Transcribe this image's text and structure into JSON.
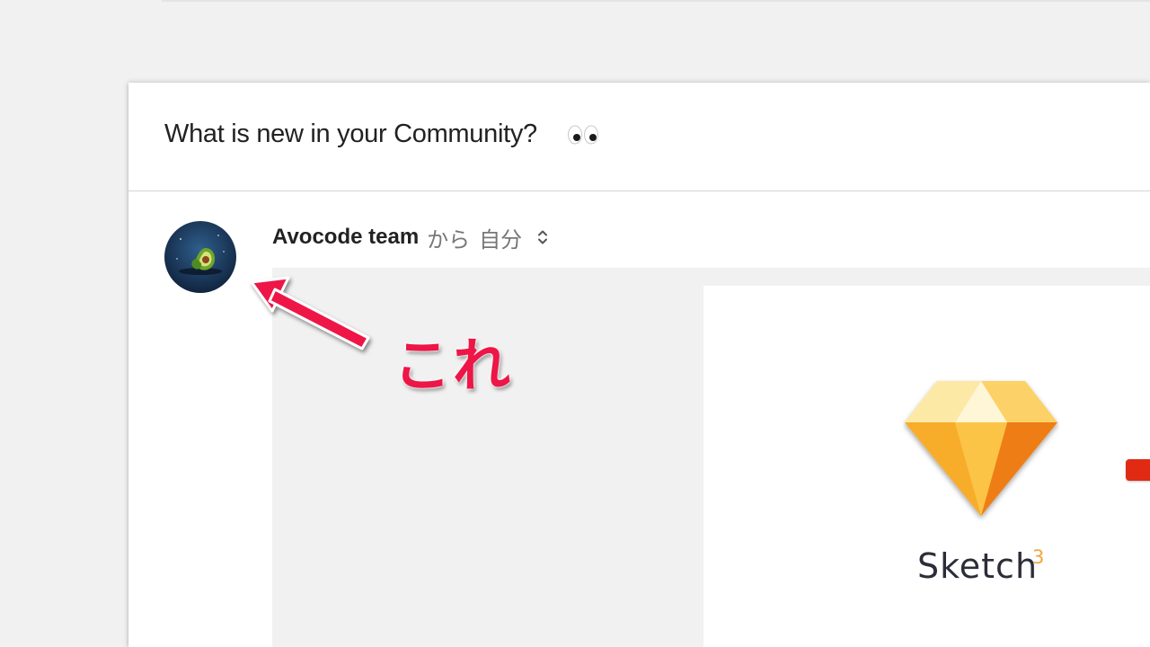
{
  "email": {
    "subject": "What is new in your Community?",
    "subject_emoji_icon": "eyes-emoji-icon",
    "sender_name": "Avocode team",
    "sender_from_label": "から",
    "recipient_label": "自分",
    "details_icon": "up-down-chevron-icon",
    "avatar_icon": "avocado-logo-icon"
  },
  "newsletter": {
    "logo_icon": "sketch-diamond-icon",
    "product_name": "Sketch",
    "product_version": "3",
    "badge_color": "#e02a13"
  },
  "annotation": {
    "text": "これ",
    "arrow_icon": "red-arrow-icon",
    "color": "#ee1547"
  }
}
